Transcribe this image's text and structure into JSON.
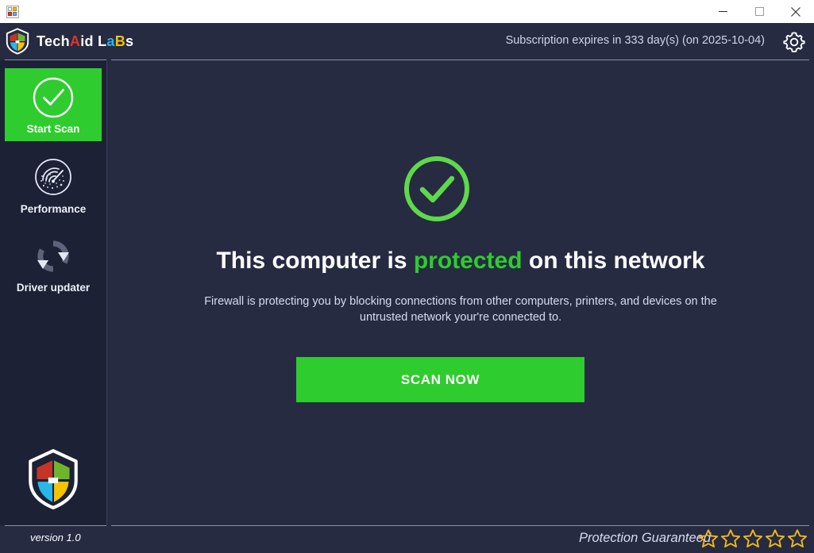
{
  "window": {
    "app_icon": "app-tiles-icon",
    "minimize_label": "Minimize",
    "maximize_label": "Maximize",
    "close_label": "Close"
  },
  "header": {
    "brand": {
      "logo": "shield-logo-icon",
      "part1": "Tech",
      "part2": "A",
      "part3": "id",
      "part4": " L",
      "part5": "a",
      "part6": "B",
      "part7": "s"
    },
    "subscription_text": "Subscription expires in 333 day(s) (on 2025-10-04)",
    "settings_icon": "gear-icon"
  },
  "sidebar": {
    "items": [
      {
        "label": "Start Scan",
        "icon": "check-circle-icon",
        "active": true
      },
      {
        "label": "Performance",
        "icon": "speedometer-icon",
        "active": false
      },
      {
        "label": "Driver updater",
        "icon": "sync-refresh-icon",
        "active": false
      }
    ],
    "brand_shield_icon": "shield-logo-icon",
    "version": "version 1.0"
  },
  "main": {
    "status_icon": "check-circle-icon",
    "headline_prefix": "This computer is ",
    "headline_status": "protected",
    "headline_suffix": " on this network",
    "description": "Firewall is protecting you by blocking connections from other computers, printers, and devices on the untrusted network your're connected to.",
    "scan_button": "SCAN NOW"
  },
  "footer": {
    "guarantee_text": "Protection Guaranteed",
    "star_count": 5,
    "star_icon": "star-outline-icon"
  },
  "colors": {
    "accent_green": "#2ecc2e",
    "background": "#262b42",
    "sidebar_background": "#1d2136",
    "star_gold": "#f5b817",
    "brand_red": "#e0352b",
    "brand_cyan": "#29b6e8",
    "brand_yellow": "#f2c200"
  }
}
